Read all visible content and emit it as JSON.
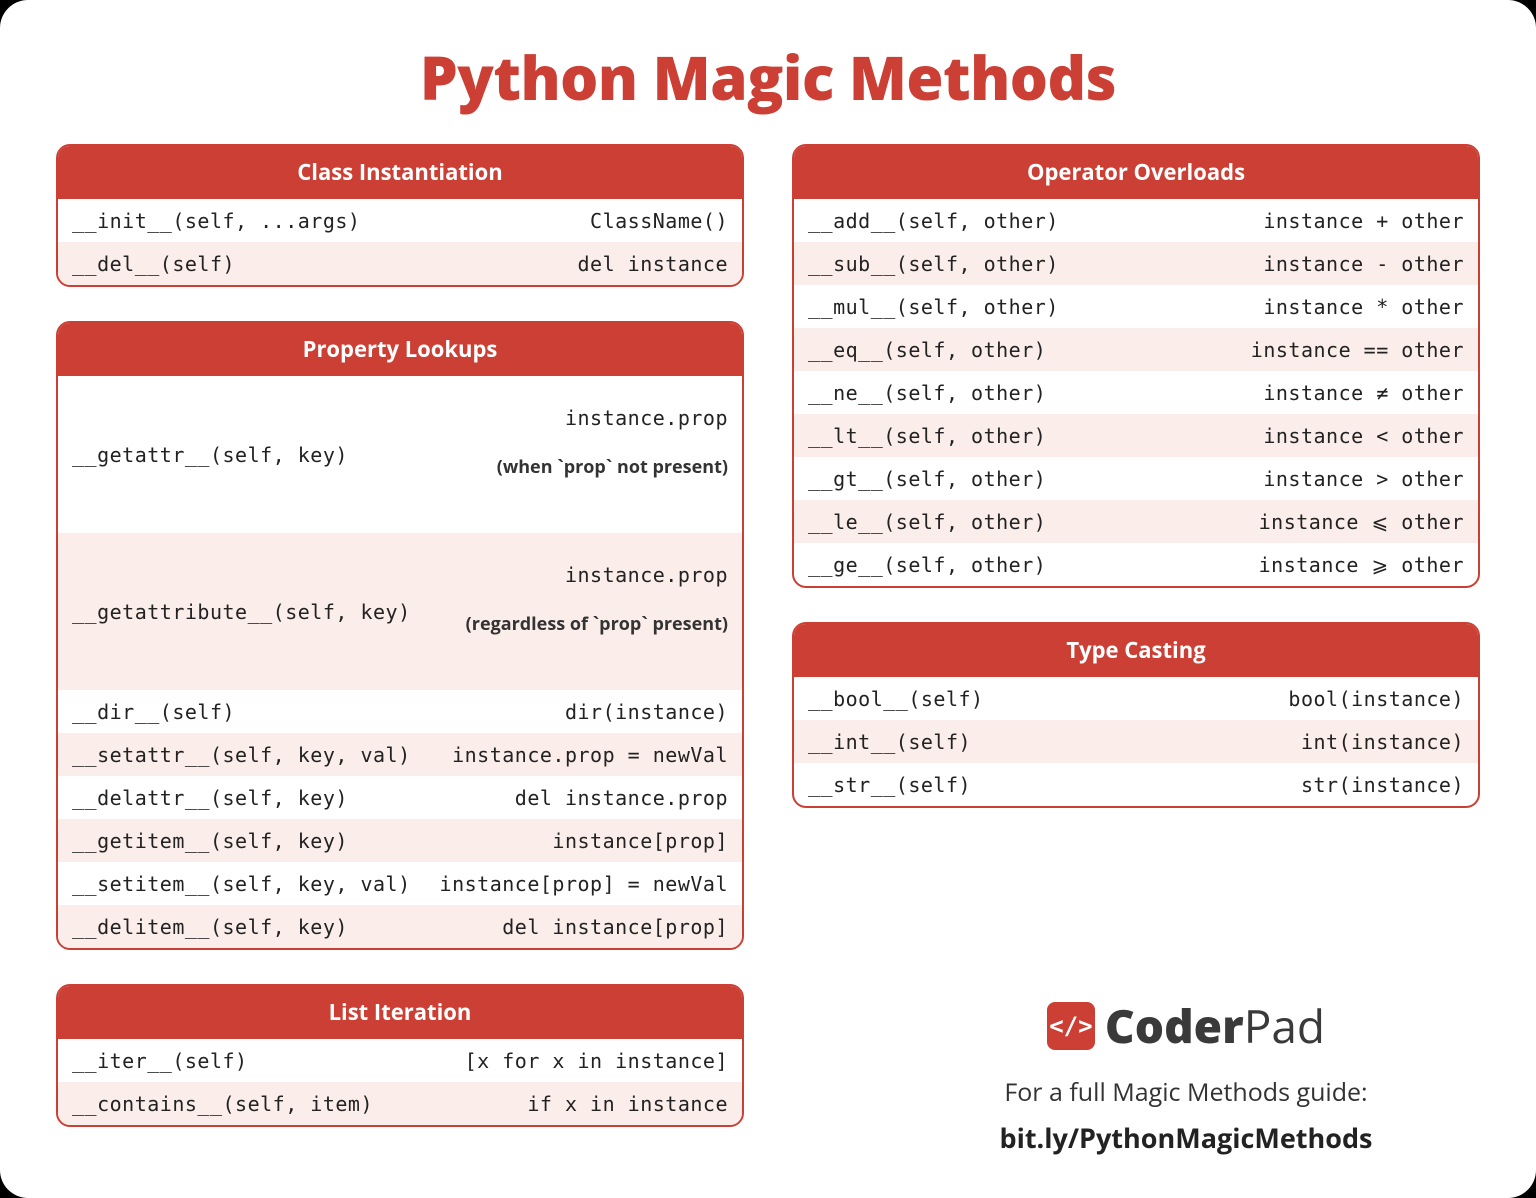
{
  "title": "Python Magic Methods",
  "colors": {
    "accent": "#cc3f34",
    "stripe": "#fbede9"
  },
  "sections": {
    "class_instantiation": {
      "header": "Class Instantiation",
      "rows": [
        {
          "left": "__init__(self, ...args)",
          "right": "ClassName()"
        },
        {
          "left": "__del__(self)",
          "right": "del instance"
        }
      ]
    },
    "property_lookups": {
      "header": "Property Lookups",
      "rows": [
        {
          "left": "__getattr__(self, key)",
          "right": "instance.prop",
          "note": "(when `prop` not present)"
        },
        {
          "left": "__getattribute__(self, key)",
          "right": "instance.prop",
          "note": "(regardless of `prop` present)"
        },
        {
          "left": "__dir__(self)",
          "right": "dir(instance)"
        },
        {
          "left": "__setattr__(self, key, val)",
          "right": "instance.prop = newVal"
        },
        {
          "left": "__delattr__(self, key)",
          "right": "del instance.prop"
        },
        {
          "left": "__getitem__(self, key)",
          "right": "instance[prop]"
        },
        {
          "left": "__setitem__(self, key, val)",
          "right": "instance[prop] = newVal"
        },
        {
          "left": "__delitem__(self, key)",
          "right": "del instance[prop]"
        }
      ]
    },
    "list_iteration": {
      "header": "List Iteration",
      "rows": [
        {
          "left": "__iter__(self)",
          "right": "[x for x in instance]"
        },
        {
          "left": "__contains__(self, item)",
          "right": "if x in instance"
        }
      ]
    },
    "operator_overloads": {
      "header": "Operator Overloads",
      "rows": [
        {
          "left": "__add__(self, other)",
          "right": "instance + other"
        },
        {
          "left": "__sub__(self, other)",
          "right": "instance - other"
        },
        {
          "left": "__mul__(self, other)",
          "right": "instance * other"
        },
        {
          "left": "__eq__(self, other)",
          "right": "instance == other"
        },
        {
          "left": "__ne__(self, other)",
          "right": "instance ≠ other"
        },
        {
          "left": "__lt__(self, other)",
          "right": "instance < other"
        },
        {
          "left": "__gt__(self, other)",
          "right": "instance > other"
        },
        {
          "left": "__le__(self, other)",
          "right": "instance ⩽ other"
        },
        {
          "left": "__ge__(self, other)",
          "right": "instance ⩾ other"
        }
      ]
    },
    "type_casting": {
      "header": "Type Casting",
      "rows": [
        {
          "left": "__bool__(self)",
          "right": "bool(instance)"
        },
        {
          "left": "__int__(self)",
          "right": "int(instance)"
        },
        {
          "left": "__str__(self)",
          "right": "str(instance)"
        }
      ]
    }
  },
  "footer": {
    "brand_icon": "</>",
    "brand_bold": "Coder",
    "brand_light": "Pad",
    "tagline": "For a full Magic Methods guide:",
    "link": "bit.ly/PythonMagicMethods"
  }
}
